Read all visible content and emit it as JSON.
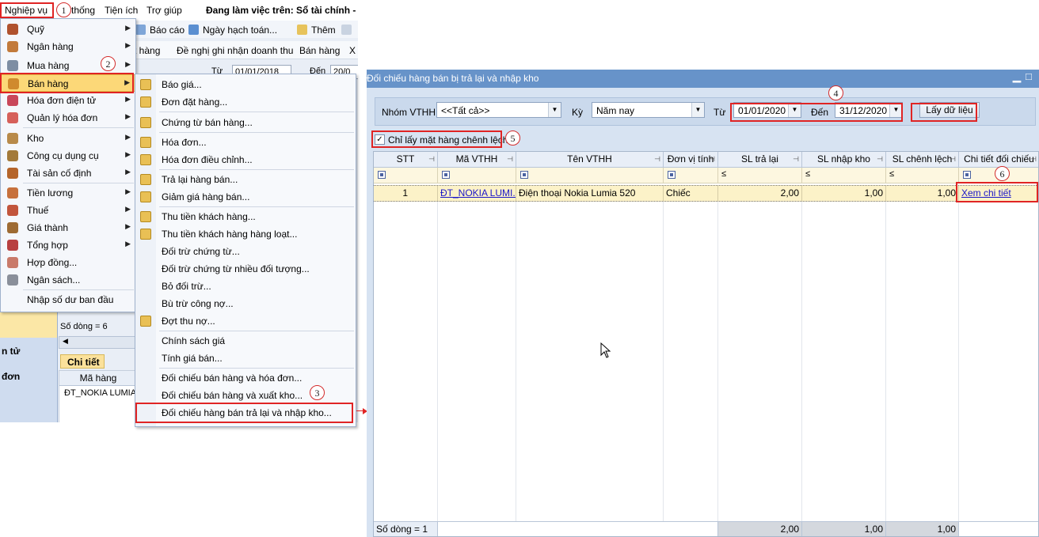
{
  "app": {
    "menubar": {
      "items": [
        "Nghiệp vụ",
        "thống",
        "Tiện ích",
        "Trợ giúp"
      ],
      "workspace_label": "Đang làm việc trên: Sổ tài chính - /"
    },
    "toolbar1": {
      "report": "Báo cáo",
      "posting_date": "Ngày hạch toán...",
      "add": "Thêm"
    },
    "toolbar2": {
      "item1": "t hàng",
      "item2": "Đề nghị ghi nhận doanh thu",
      "item3": "Bán hàng",
      "item4": "X"
    },
    "datebar": {
      "from_label": "Từ",
      "from_value": "01/01/2018",
      "to_label": "Đến",
      "to_value": "20/0"
    },
    "lower_left": {
      "item1": "n tử",
      "item2": "đơn"
    },
    "rows_count": "Số dòng = 6",
    "detail_tab": "Chi tiết",
    "detail_grid": {
      "header": "Mã hàng",
      "row1": "ĐT_NOKIA LUMIA"
    }
  },
  "menu1": {
    "items": [
      {
        "label": "Quỹ",
        "submenu": true
      },
      {
        "label": "Ngân hàng",
        "submenu": true
      },
      {
        "label": "Mua hàng",
        "submenu": true
      },
      {
        "label": "Bán hàng",
        "submenu": true
      },
      {
        "label": "Hóa đơn điện tử",
        "submenu": true
      },
      {
        "label": "Quản lý hóa đơn",
        "submenu": true
      },
      {
        "label": "Kho",
        "submenu": true
      },
      {
        "label": "Công cụ dụng cụ",
        "submenu": true
      },
      {
        "label": "Tài sản cố định",
        "submenu": true
      },
      {
        "label": "Tiền lương",
        "submenu": true
      },
      {
        "label": "Thuế",
        "submenu": true
      },
      {
        "label": "Giá thành",
        "submenu": true
      },
      {
        "label": "Tổng hợp",
        "submenu": true
      },
      {
        "label": "Hợp đồng...",
        "submenu": false
      },
      {
        "label": "Ngân sách...",
        "submenu": false
      },
      {
        "label": "Nhập số dư ban đầu",
        "submenu": false
      }
    ]
  },
  "menu2": {
    "items": [
      "Báo giá...",
      "Đơn đặt hàng...",
      "Chứng từ bán hàng...",
      "Hóa đơn...",
      "Hóa đơn điều chỉnh...",
      "Trả lại hàng bán...",
      "Giảm giá hàng bán...",
      "Thu tiền khách hàng...",
      "Thu tiền khách hàng hàng loạt...",
      "Đối trừ chứng từ...",
      "Đối trừ chứng từ nhiều đối tượng...",
      "Bỏ đối trừ...",
      "Bù trừ công nợ...",
      "Đợt thu nợ...",
      "Chính sách giá",
      "Tính giá bán...",
      "Đối chiếu bán hàng và hóa đơn...",
      "Đối chiếu bán hàng và xuất kho...",
      "Đối chiếu hàng bán trả lại và nhập kho..."
    ]
  },
  "badges": [
    "1",
    "2",
    "3",
    "4",
    "5",
    "6"
  ],
  "dialog": {
    "title": "Đối chiếu hàng bán bị trả lại và nhập kho",
    "filters": {
      "group_label": "Nhóm VTHH",
      "group_value": "<<Tất cả>>",
      "period_label": "Kỳ",
      "period_value": "Năm nay",
      "from_label": "Từ",
      "from_value": "01/01/2020",
      "to_label": "Đến",
      "to_value": "31/12/2020",
      "load_button": "Lấy dữ liệu"
    },
    "only_diff_label": "Chỉ lấy mặt hàng chênh lệch",
    "grid": {
      "columns": [
        "STT",
        "Mã VTHH",
        "Tên VTHH",
        "Đơn vị tính",
        "SL trả lại",
        "SL nhập kho",
        "SL chênh lệch",
        "Chi tiết đối chiếu"
      ],
      "filter_ops": [
        "≤",
        "≤",
        "≤"
      ],
      "rows": [
        {
          "stt": "1",
          "code": "ĐT_NOKIA LUMI...",
          "name": "Điện thoại Nokia Lumia 520",
          "unit": "Chiếc",
          "returned": "2,00",
          "received": "1,00",
          "diff": "1,00",
          "detail": "Xem chi tiết"
        }
      ],
      "footer": {
        "count": "Số dòng = 1",
        "returned": "2,00",
        "received": "1,00",
        "diff": "1,00"
      }
    }
  },
  "colors": {
    "accent": "#6793c9",
    "highlight": "#fcd878",
    "annotation": "#e02424",
    "link": "#1a16c8"
  }
}
